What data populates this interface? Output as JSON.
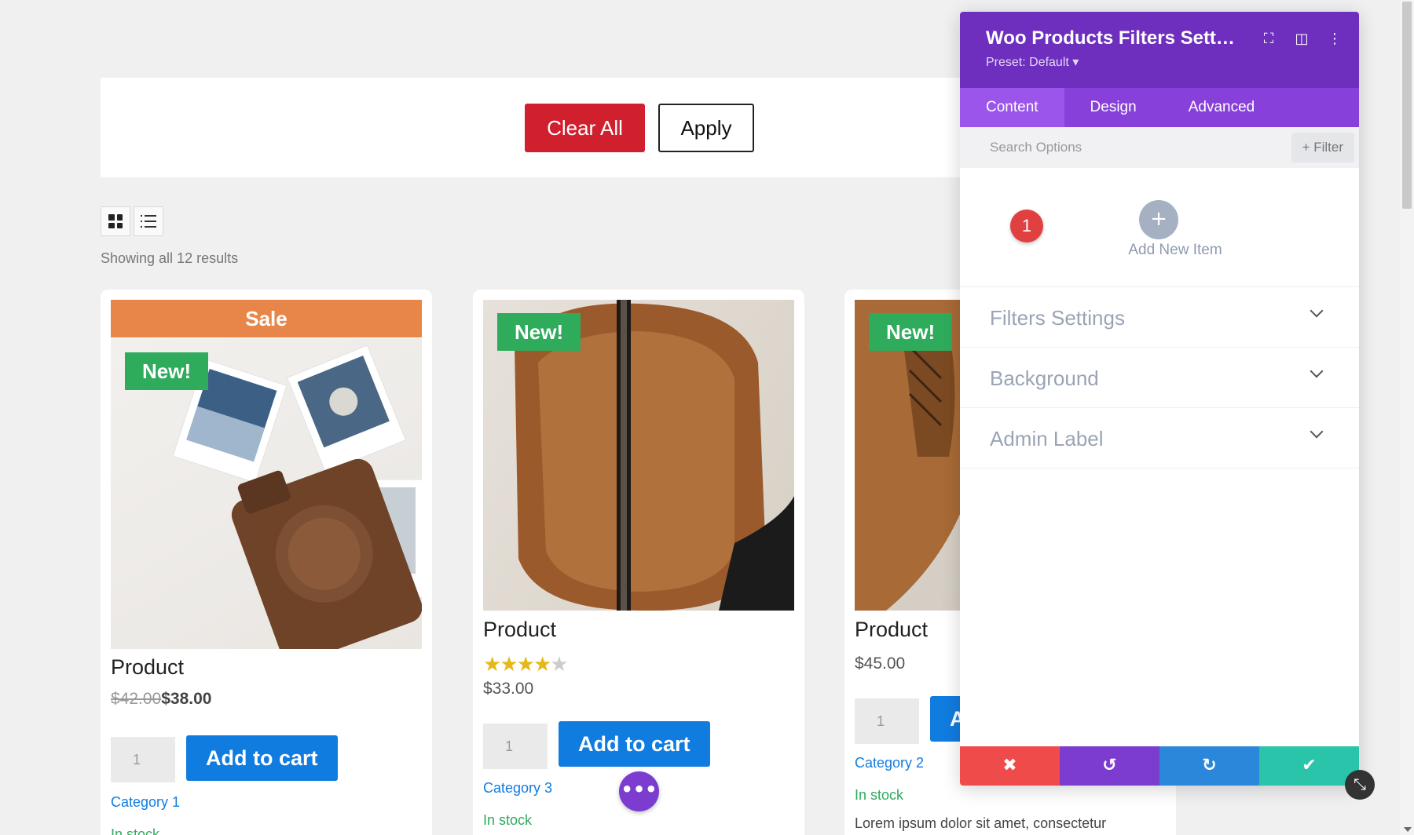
{
  "filter_bar": {
    "clear_label": "Clear All",
    "apply_label": "Apply"
  },
  "results_text": "Showing all 12 results",
  "products": [
    {
      "sale_label": "Sale",
      "badge": "New!",
      "name": "Product",
      "old_price": "$42.00",
      "price": "$38.00",
      "qty": "1",
      "cart_label": "Add to cart",
      "category": "Category 1",
      "stock": "In stock"
    },
    {
      "badge": "New!",
      "name": "Product",
      "rating": 3.5,
      "rating_max": 5,
      "price": "$33.00",
      "qty": "1",
      "cart_label": "Add to cart",
      "category": "Category 3",
      "stock": "In stock"
    },
    {
      "badge": "New!",
      "name": "Product",
      "price": "$45.00",
      "qty": "1",
      "cart_label": "A",
      "category": "Category 2",
      "stock": "In stock",
      "description": "Lorem ipsum dolor sit amet, consectetur"
    }
  ],
  "panel": {
    "title": "Woo Products Filters Settin...",
    "preset": "Preset: Default ▾",
    "tabs": [
      "Content",
      "Design",
      "Advanced"
    ],
    "search_placeholder": "Search Options",
    "filter_label": "+ Filter",
    "item_count": "1",
    "add_new_item": "Add New Item",
    "sections": [
      "Filters Settings",
      "Background",
      "Admin Label"
    ]
  },
  "colors": {
    "clear_button": "#d0202e",
    "sale_band": "#e8864a",
    "new_badge": "#2fab5c",
    "cart_button": "#117ce0",
    "panel_header": "#6e2fbf",
    "panel_tabs": "#8740d9",
    "footer_cancel": "#ef4b4b",
    "footer_undo": "#7c3ccf",
    "footer_redo": "#2b87da",
    "footer_save": "#29c4a9"
  }
}
